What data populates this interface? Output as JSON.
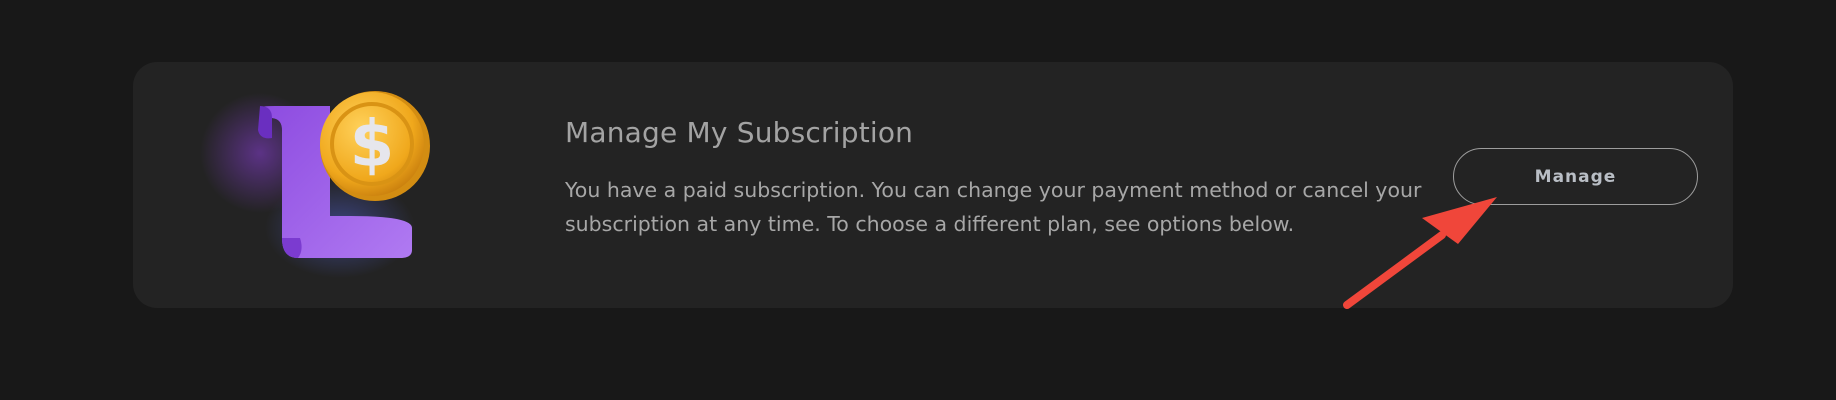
{
  "subscription": {
    "title": "Manage My Subscription",
    "description": "You have a paid subscription. You can change your payment method or cancel your subscription at any time. To choose a different plan, see options below.",
    "manage_label": "Manage"
  },
  "icons": {
    "illustration": "scroll-with-dollar-coin",
    "annotation": "red-arrow"
  },
  "colors": {
    "page_background": "#181818",
    "card_background": "#232323",
    "scroll_purple": "#9f5de6",
    "coin_gold": "#f0a81c",
    "arrow_red": "#f0463a"
  }
}
